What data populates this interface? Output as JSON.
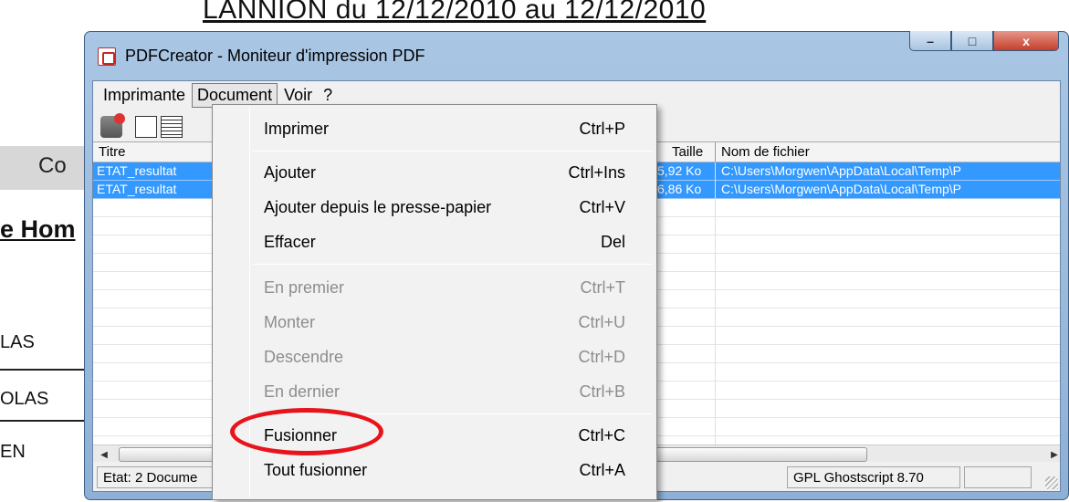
{
  "background_document": {
    "title": "LANNION du 12/12/2010 au 12/12/2010",
    "header_partial": "Co",
    "subtitle_partial": "e Hom",
    "rows": [
      "LAS",
      "OLAS",
      "EN"
    ]
  },
  "window": {
    "title": "PDFCreator - Moniteur d'impression PDF",
    "controls": {
      "minimize": "–",
      "maximize": "□",
      "close": "x"
    }
  },
  "menubar": {
    "items": [
      {
        "label": "Imprimante"
      },
      {
        "label": "Document"
      },
      {
        "label": "Voir"
      },
      {
        "label": "?"
      }
    ]
  },
  "listview": {
    "columns": {
      "title": "Titre",
      "size": "Taille",
      "filename": "Nom de fichier"
    },
    "rows": [
      {
        "title": "ETAT_resultat",
        "size": "5,92 Ko",
        "filename": "C:\\Users\\Morgwen\\AppData\\Local\\Temp\\P"
      },
      {
        "title": "ETAT_resultat",
        "size": "6,86 Ko",
        "filename": "C:\\Users\\Morgwen\\AppData\\Local\\Temp\\P"
      }
    ]
  },
  "statusbar": {
    "status": "Etat: 2 Docume",
    "ghostscript": "GPL Ghostscript 8.70"
  },
  "document_menu": {
    "items": [
      {
        "label": "Imprimer",
        "shortcut": "Ctrl+P",
        "enabled": true
      },
      {
        "label": "Ajouter",
        "shortcut": "Ctrl+Ins",
        "enabled": true
      },
      {
        "label": "Ajouter depuis le presse-papier",
        "shortcut": "Ctrl+V",
        "enabled": true
      },
      {
        "label": "Effacer",
        "shortcut": "Del",
        "enabled": true
      },
      {
        "label": "En premier",
        "shortcut": "Ctrl+T",
        "enabled": false
      },
      {
        "label": "Monter",
        "shortcut": "Ctrl+U",
        "enabled": false
      },
      {
        "label": "Descendre",
        "shortcut": "Ctrl+D",
        "enabled": false
      },
      {
        "label": "En dernier",
        "shortcut": "Ctrl+B",
        "enabled": false
      },
      {
        "label": "Fusionner",
        "shortcut": "Ctrl+C",
        "enabled": true
      },
      {
        "label": "Tout fusionner",
        "shortcut": "Ctrl+A",
        "enabled": true
      }
    ]
  },
  "annotation": {
    "color": "#e8141c",
    "target": "Fusionner"
  },
  "colors": {
    "selection": "#3399ff",
    "window_frame": "#a9c6e4",
    "close_button": "#c4402b"
  }
}
